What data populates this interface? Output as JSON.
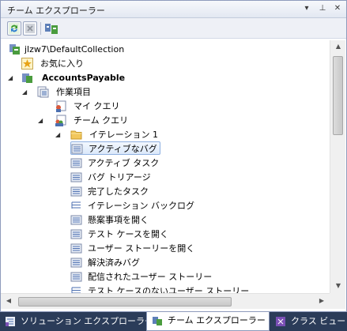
{
  "panel": {
    "title": "チーム エクスプローラー",
    "dropdown_glyph": "▾",
    "pin_glyph": "⊥",
    "close_glyph": "✕"
  },
  "toolbar": {
    "buttons": [
      "refresh-icon",
      "stop-icon",
      "connect-to-team-project-icon"
    ]
  },
  "tree": {
    "collection": "jlzw7\\DefaultCollection",
    "favorites": "お気に入り",
    "project": "AccountsPayable",
    "work_items": "作業項目",
    "my_queries": "マイ クエリ",
    "team_queries": "チーム クエリ",
    "iteration_folder": "イテレーション 1",
    "queries": [
      "アクティブなバグ",
      "アクティブ タスク",
      "バグ トリアージ",
      "完了したタスク",
      "イテレーション バックログ",
      "懸案事項を開く",
      "テスト ケースを開く",
      "ユーザー ストーリーを開く",
      "解決済みバグ",
      "配信されたユーザー ストーリー",
      "テスト ケースのないユーザー ストーリー"
    ]
  },
  "tabs": [
    {
      "label": "ソリューション エクスプローラー",
      "icon": "solution-explorer-icon"
    },
    {
      "label": "チーム エクスプローラー",
      "icon": "team-explorer-icon"
    },
    {
      "label": "クラス ビュー",
      "icon": "class-view-icon"
    }
  ],
  "colors": {
    "selection": "#dbe8fa",
    "tab_strip": "#2b3c59",
    "folder": "#f2c75c"
  }
}
